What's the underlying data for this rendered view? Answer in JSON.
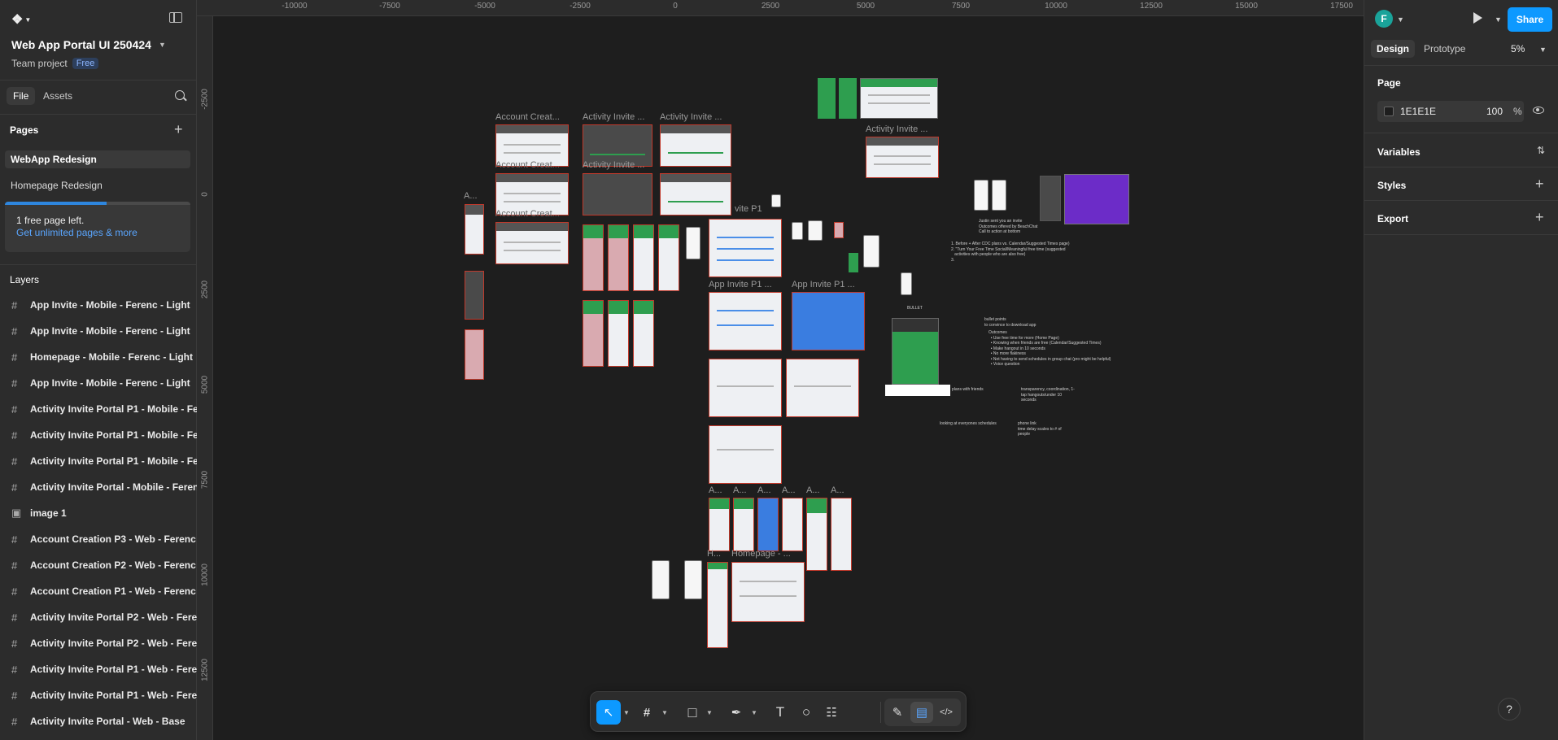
{
  "left": {
    "file_name": "Web App Portal UI 250424",
    "team": "Team project",
    "plan_badge": "Free",
    "tabs": [
      "File",
      "Assets"
    ],
    "pages_title": "Pages",
    "pages": [
      {
        "label": "WebApp Redesign",
        "active": true
      },
      {
        "label": "Homepage Redesign",
        "active": false
      }
    ],
    "promo": {
      "text": "1 free page left.",
      "link": "Get unlimited pages & more",
      "progress": 0.55
    },
    "layers_title": "Layers",
    "layers": [
      {
        "icon": "frame-icon",
        "label": "App Invite - Mobile - Ferenc - Light"
      },
      {
        "icon": "frame-icon",
        "label": "App Invite - Mobile - Ferenc - Light"
      },
      {
        "icon": "frame-icon",
        "label": "Homepage - Mobile - Ferenc - Light"
      },
      {
        "icon": "frame-icon",
        "label": "App Invite - Mobile - Ferenc - Light"
      },
      {
        "icon": "frame-icon",
        "label": "Activity Invite Portal P1 - Mobile - Fere"
      },
      {
        "icon": "frame-icon",
        "label": "Activity Invite Portal P1 - Mobile - Fere"
      },
      {
        "icon": "frame-icon",
        "label": "Activity Invite Portal P1 - Mobile - Fere"
      },
      {
        "icon": "frame-icon",
        "label": "Activity Invite Portal - Mobile - Ferenc"
      },
      {
        "icon": "image-icon",
        "label": "image 1"
      },
      {
        "icon": "frame-icon",
        "label": "Account Creation P3 - Web - Ferenc"
      },
      {
        "icon": "frame-icon",
        "label": "Account Creation P2 - Web - Ferenc"
      },
      {
        "icon": "frame-icon",
        "label": "Account Creation P1 - Web - Ferenc"
      },
      {
        "icon": "frame-icon",
        "label": "Activity Invite Portal P2 - Web - Ferenc"
      },
      {
        "icon": "frame-icon",
        "label": "Activity Invite Portal P2 - Web - Ferenc"
      },
      {
        "icon": "frame-icon",
        "label": "Activity Invite Portal P1 - Web - Ferenc"
      },
      {
        "icon": "frame-icon",
        "label": "Activity Invite Portal P1 - Web - Ferenc"
      },
      {
        "icon": "frame-icon",
        "label": "Activity Invite Portal - Web - Base"
      }
    ]
  },
  "rulers": {
    "top": [
      "-10000",
      "-7500",
      "-5000",
      "-2500",
      "0",
      "2500",
      "5000",
      "7500",
      "10000",
      "12500",
      "15000",
      "17500"
    ],
    "left": [
      "-2500",
      "0",
      "2500",
      "5000",
      "7500",
      "10000",
      "12500"
    ]
  },
  "canvas": {
    "labels": {
      "account_creation": "Account Creat...",
      "activity_invite": "Activity Invite ...",
      "app_invite_p1": "App Invite P1 ...",
      "app_invite_p1_short": "vite P1",
      "homepage": "Homepage - ...",
      "a_short": "A...",
      "h_short": "H...",
      "bullet": "BULLET"
    },
    "notes": {
      "n1": "Justin sent you an invite\nOutcomes offered by BeachChat\nCall to action at bottom",
      "n2": "1. Before + After CDC plans vs. Calendar/Suggested Times page)\n2. \"Turn Your Free Time Social/Meaningful free time (suggested\n   activities with people who are also free)\n3.",
      "n3": "bullet points\nto convince to download app",
      "n4": "Outcomes\n  • Use free time for more (Home Page)\n  • Knowing when friends are free (Calendar/Suggested Times)\n  • Make hangout in 10 seconds\n  • No more flakiness\n  • Not having to send schedules in group chat (pro might be helpful)\n  • Voice question",
      "n5": "plans with friends",
      "n6": "transparency, coordination, 1-\ntap hangouts/under 10\nseconds",
      "n7": "looking at everyones schedules",
      "n8": "phone link\ntime delay scales to # of\npeople"
    }
  },
  "right": {
    "avatar_initial": "F",
    "share_label": "Share",
    "tabs": [
      "Design",
      "Prototype"
    ],
    "zoom": "5%",
    "page_title": "Page",
    "fill_hex": "1E1E1E",
    "fill_opacity": "100",
    "fill_unit": "%",
    "sections": [
      "Variables",
      "Styles",
      "Export"
    ],
    "help": "?"
  },
  "toolbar": {
    "tools": [
      {
        "name": "move-tool",
        "glyph": "↖",
        "active": true
      },
      {
        "name": "frame-tool",
        "glyph": "#",
        "active": false
      },
      {
        "name": "rectangle-tool",
        "glyph": "□",
        "active": false
      },
      {
        "name": "pen-tool",
        "glyph": "✒",
        "active": false
      },
      {
        "name": "text-tool",
        "glyph": "T",
        "active": false
      },
      {
        "name": "comment-tool",
        "glyph": "○",
        "active": false
      },
      {
        "name": "actions-tool",
        "glyph": "☷",
        "active": false
      },
      {
        "name": "draw-mode",
        "glyph": "✎",
        "active": false
      },
      {
        "name": "design-mode",
        "glyph": "▤",
        "active": true
      },
      {
        "name": "dev-mode",
        "glyph": "</>",
        "active": false
      }
    ]
  },
  "colors": {
    "accent": "#0d99ff",
    "canvas": "#1e1e1e",
    "panel": "#2c2c2c"
  }
}
